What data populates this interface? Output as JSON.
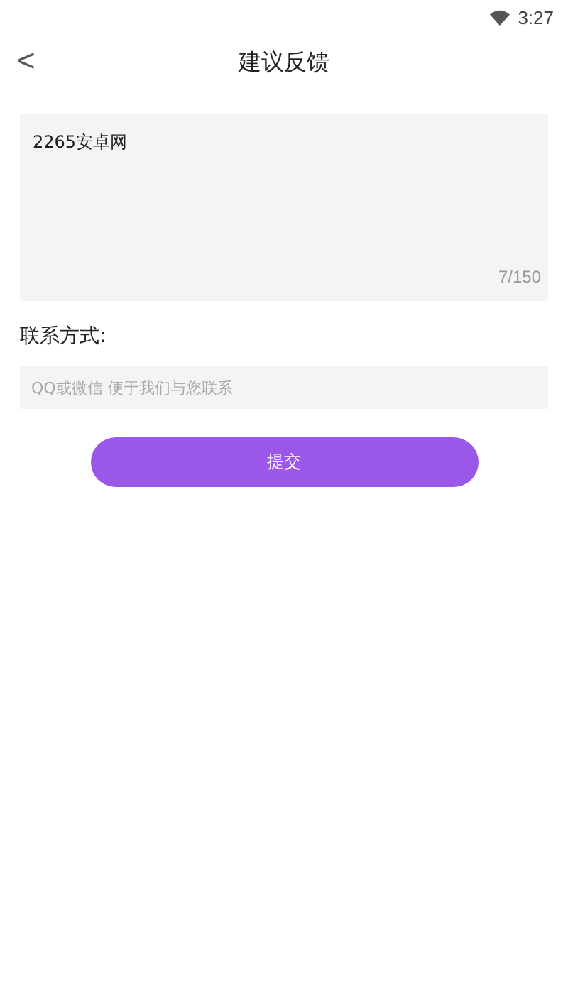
{
  "status_bar": {
    "time": "3:27"
  },
  "header": {
    "back": "<",
    "title": "建议反馈"
  },
  "feedback": {
    "value": "2265安卓网",
    "counter": "7/150"
  },
  "contact": {
    "label": "联系方式:",
    "placeholder": "QQ或微信 便于我们与您联系"
  },
  "submit": {
    "label": "提交"
  }
}
